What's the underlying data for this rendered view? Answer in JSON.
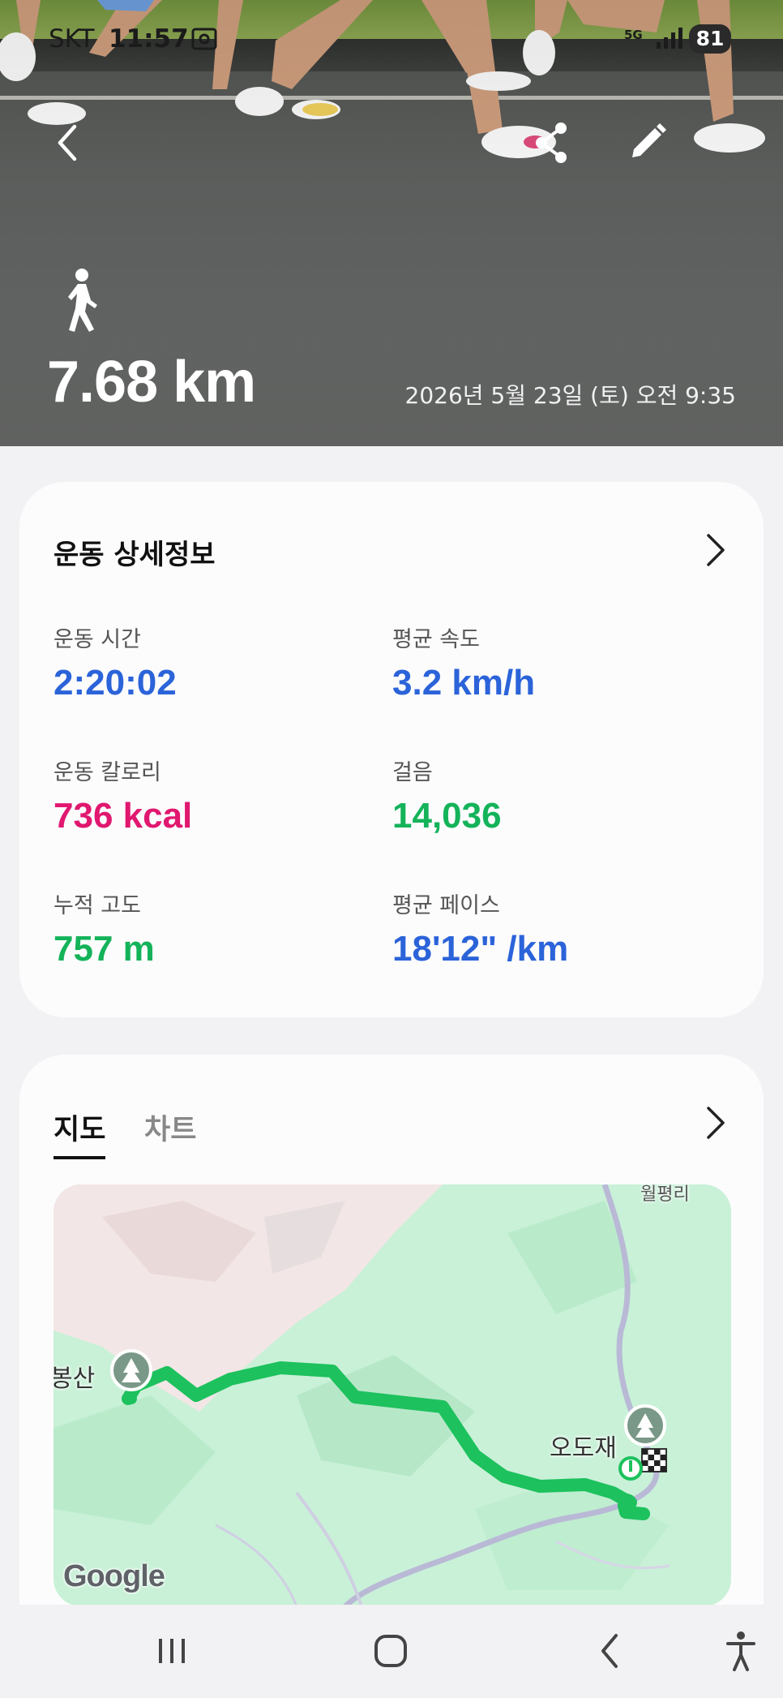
{
  "status_bar": {
    "carrier": "SKT",
    "time": "11:57",
    "network": "5G",
    "battery": "81"
  },
  "header": {
    "activity_icon": "walking-person-icon",
    "distance": "7.68 km",
    "datetime": "2026년 5월 23일 (토) 오전 9:35"
  },
  "details": {
    "title": "운동 상세정보",
    "stats": [
      {
        "label": "운동 시간",
        "value": "2:20:02",
        "color": "#2b63d9"
      },
      {
        "label": "평균 속도",
        "value": "3.2 km/h",
        "color": "#2b63d9"
      },
      {
        "label": "운동 칼로리",
        "value": "736 kcal",
        "color": "#e0186f"
      },
      {
        "label": "걸음",
        "value": "14,036",
        "color": "#14b35a"
      },
      {
        "label": "누적 고도",
        "value": "757 m",
        "color": "#14b35a"
      },
      {
        "label": "평균 페이스",
        "value": "18'12\" /km",
        "color": "#2b63d9"
      }
    ]
  },
  "map_card": {
    "tabs": [
      "지도",
      "차트"
    ],
    "active_tab": "지도",
    "labels": {
      "left": "봉산",
      "right": "오도재",
      "top": "월평리"
    },
    "attribution": "Google"
  },
  "nav_bar": {
    "buttons": [
      "recent-apps",
      "home",
      "back",
      "accessibility"
    ]
  }
}
